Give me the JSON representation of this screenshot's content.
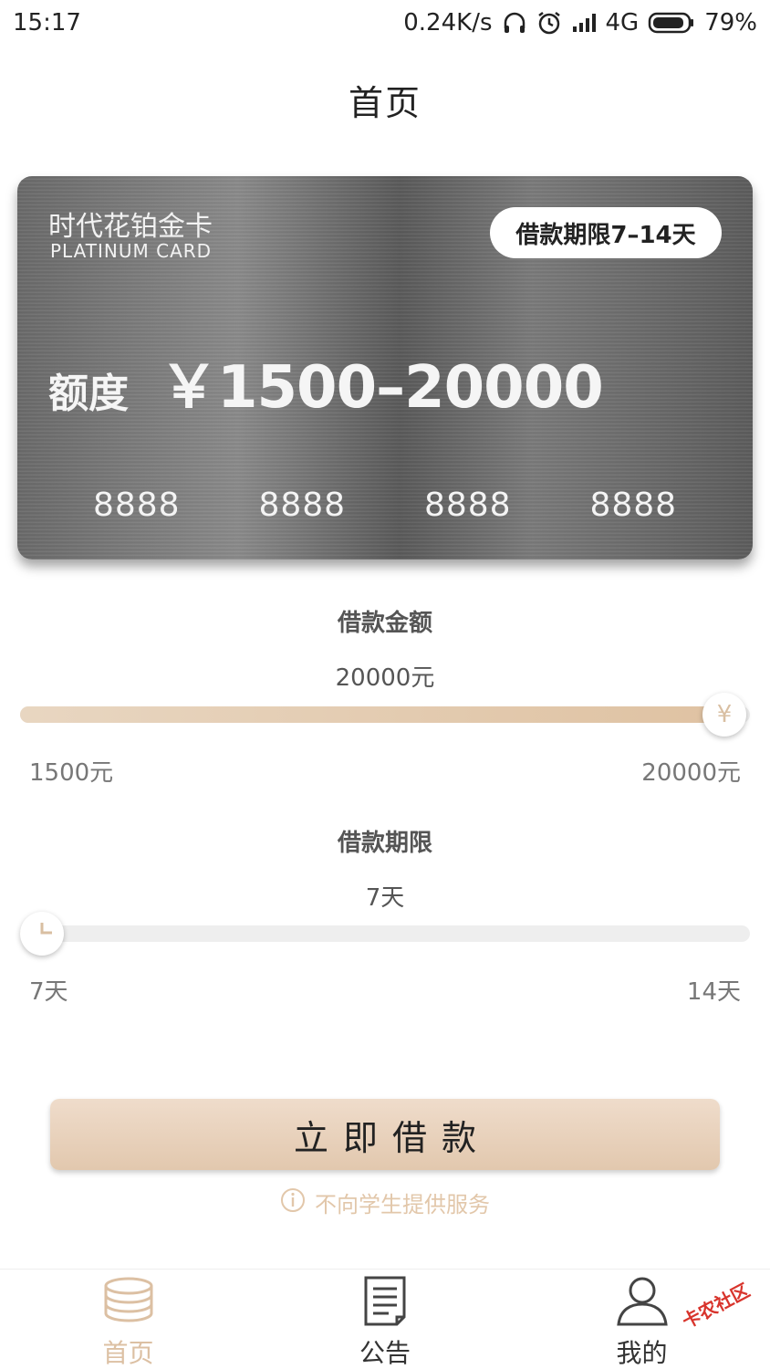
{
  "status": {
    "time": "15:17",
    "net_speed": "0.24K/s",
    "network": "4G",
    "battery": "79%"
  },
  "header": {
    "title": "首页"
  },
  "card": {
    "name": "时代花铂金卡",
    "name_en": "PLATINUM CARD",
    "term_badge": "借款期限7–14天",
    "limit_label": "额度",
    "limit_value": "￥1500–20000",
    "numbers": [
      "8888",
      "8888",
      "8888",
      "8888"
    ]
  },
  "amount": {
    "label": "借款金额",
    "value": "20000元",
    "min": "1500元",
    "max": "20000元",
    "fraction": 1.0,
    "thumb_symbol": "¥"
  },
  "term": {
    "label": "借款期限",
    "value": "7天",
    "min": "7天",
    "max": "14天",
    "fraction": 0.0
  },
  "action": {
    "button_label": "立即借款"
  },
  "notice": {
    "text": "不向学生提供服务"
  },
  "tabs": [
    {
      "label": "首页",
      "icon": "coins-icon",
      "active": true
    },
    {
      "label": "公告",
      "icon": "document-icon",
      "active": false
    },
    {
      "label": "我的",
      "icon": "user-icon",
      "active": false
    }
  ],
  "watermark": {
    "text": "卡农社区"
  },
  "colors": {
    "accent": "#dcc0a3",
    "track": "#eeeeee",
    "button": "#e6cfb7"
  }
}
